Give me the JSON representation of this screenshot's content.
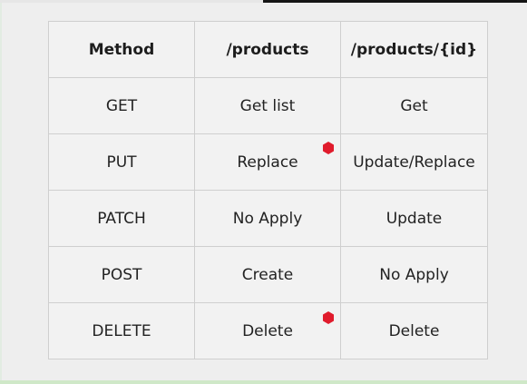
{
  "table": {
    "headers": [
      "Method",
      "/products",
      "/products/{id}"
    ],
    "rows": [
      [
        "GET",
        "Get list",
        "Get"
      ],
      [
        "PUT",
        "Replace",
        "Update/Replace"
      ],
      [
        "PATCH",
        "No Apply",
        "Update"
      ],
      [
        "POST",
        "Create",
        "No Apply"
      ],
      [
        "DELETE",
        "Delete",
        "Delete"
      ]
    ]
  },
  "colors": {
    "marker": "#e01b2c",
    "border": "#cfcfcf",
    "background": "#eeeeee"
  }
}
